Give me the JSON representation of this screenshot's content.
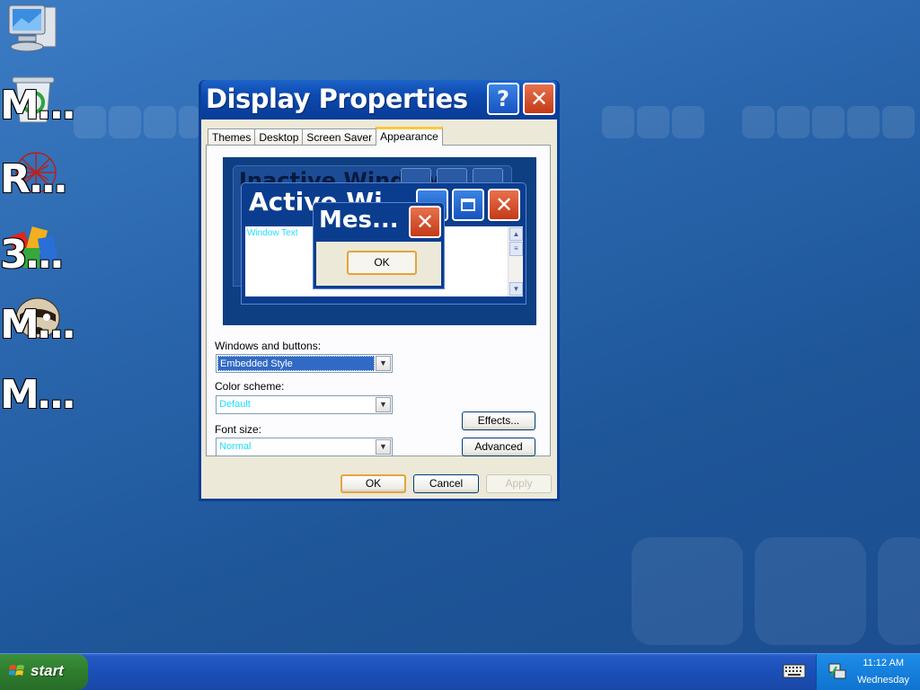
{
  "desktop": {
    "icons": [
      {
        "label": "",
        "icon": "my-computer-icon"
      },
      {
        "label": "M...",
        "icon": "recycle-bin-icon"
      },
      {
        "label": "R...",
        "icon": "network-art-icon"
      },
      {
        "label": "3...",
        "icon": "colorful-blocks-icon"
      },
      {
        "label": "M...",
        "icon": "raccoon-icon"
      },
      {
        "label": "M...",
        "icon": "generic-icon"
      }
    ]
  },
  "dialog": {
    "title": "Display Properties",
    "help_label": "?",
    "close_label": "✕",
    "tabs": [
      "Themes",
      "Desktop",
      "Screen Saver",
      "Appearance"
    ],
    "active_tab": "Appearance",
    "preview": {
      "inactive_title": "Inactive Window",
      "active_title": "Active Wi",
      "window_text": "Window Text",
      "message_title": "Mes...",
      "message_ok": "OK"
    },
    "windows_buttons_label": "Windows and buttons:",
    "windows_buttons_value": "Embedded Style",
    "color_scheme_label": "Color scheme:",
    "color_scheme_value": "Default",
    "font_size_label": "Font size:",
    "font_size_value": "Normal",
    "effects_label": "Effects...",
    "advanced_label": "Advanced",
    "ok_label": "OK",
    "cancel_label": "Cancel",
    "apply_label": "Apply"
  },
  "taskbar": {
    "start_label": "start",
    "time": "11:12 AM",
    "day": "Wednesday"
  },
  "colors": {
    "titlebar": "#0c49b0",
    "close": "#c43a17",
    "taskbar": "#1a4fb8",
    "start": "#2e7d2e",
    "accent_text": "#1edcff"
  }
}
